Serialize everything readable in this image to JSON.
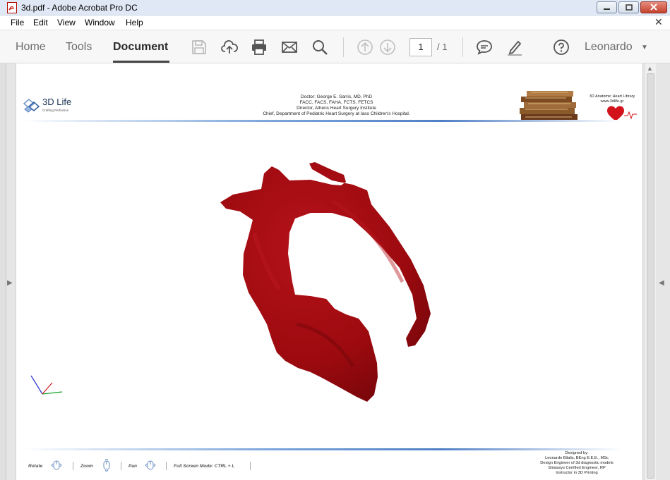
{
  "window": {
    "title": "3d.pdf - Adobe Acrobat Pro DC",
    "close_symbol": "✕"
  },
  "menu": [
    "File",
    "Edit",
    "View",
    "Window",
    "Help"
  ],
  "tabs": {
    "home": "Home",
    "tools": "Tools",
    "document": "Document"
  },
  "toolbar": {
    "page_current": "1",
    "page_total": "/ 1",
    "user": "Leonardo",
    "icons": [
      "save-icon",
      "upload-icon",
      "print-icon",
      "email-icon",
      "search-icon",
      "page-up-icon",
      "page-down-icon",
      "comment-icon",
      "sign-icon",
      "help-icon"
    ]
  },
  "pdf": {
    "logo_title": "3D Life",
    "logo_sub": "Crafting Perfection",
    "header_lines": [
      "Doctor: George E. Sarris, MD, PhD",
      "FACC, FACS, FAHA, FCTS, FETCS",
      "Director, Athens Heart Surgery Institute",
      "Chief, Department of Pediatric Heart Surgery at Iaso Children's Hospital."
    ],
    "library_lines": [
      "3D Anatomic Heart Library",
      "www.3dlife.gr"
    ],
    "footer_controls": {
      "rotate": "Rotate",
      "zoom": "Zoom",
      "pan": "Pan",
      "fullscreen": "Full Screen Mode:  CTRL + L"
    },
    "designer_lines": [
      "Designed by:",
      "Leonardo Bilalis, BEng E.E.E., MSc",
      "Design Engineer of 3d diagnostic models",
      "Stratasys Certified Engineer, RP",
      "Instructor in 3D Printing"
    ]
  },
  "colors": {
    "model": "#9c0a0f",
    "accent": "#4f7fc6",
    "titlebar": "#dfe8f4"
  }
}
